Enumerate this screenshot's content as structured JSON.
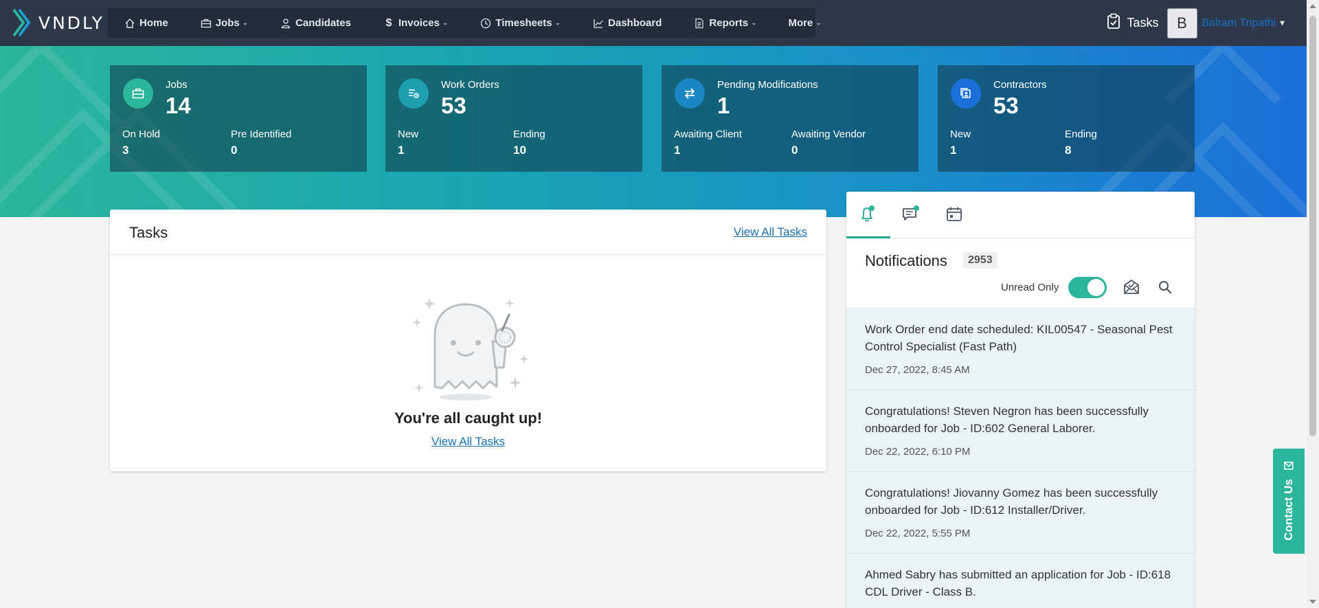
{
  "brand": {
    "name": "VNDLY"
  },
  "nav": {
    "items": [
      {
        "label": "Home",
        "icon": "home-icon",
        "dropdown": false
      },
      {
        "label": "Jobs",
        "icon": "briefcase-icon",
        "dropdown": true
      },
      {
        "label": "Candidates",
        "icon": "person-icon",
        "dropdown": false
      },
      {
        "label": "Invoices",
        "icon": "dollar-icon",
        "dropdown": true
      },
      {
        "label": "Timesheets",
        "icon": "clock-icon",
        "dropdown": true
      },
      {
        "label": "Dashboard",
        "icon": "chart-icon",
        "dropdown": false
      },
      {
        "label": "Reports",
        "icon": "document-icon",
        "dropdown": true
      },
      {
        "label": "More",
        "icon": "",
        "dropdown": true
      }
    ],
    "tasks_label": "Tasks",
    "avatar_initial": "B",
    "user_name": "Balram Tripathi"
  },
  "stats": [
    {
      "title": "Jobs",
      "value": "14",
      "icon": "briefcase-icon",
      "icon_color": "#2bb59b",
      "sub": [
        {
          "label": "On Hold",
          "value": "3"
        },
        {
          "label": "Pre Identified",
          "value": "0"
        }
      ]
    },
    {
      "title": "Work Orders",
      "value": "53",
      "icon": "work-order-icon",
      "icon_color": "#1d9fb0",
      "sub": [
        {
          "label": "New",
          "value": "1"
        },
        {
          "label": "Ending",
          "value": "10"
        }
      ]
    },
    {
      "title": "Pending Modifications",
      "value": "1",
      "icon": "swap-arrows-icon",
      "icon_color": "#1b86c4",
      "sub": [
        {
          "label": "Awaiting Client",
          "value": "1"
        },
        {
          "label": "Awaiting Vendor",
          "value": "0"
        }
      ]
    },
    {
      "title": "Contractors",
      "value": "53",
      "icon": "contractor-badge-icon",
      "icon_color": "#1b6fd8",
      "sub": [
        {
          "label": "New",
          "value": "1"
        },
        {
          "label": "Ending",
          "value": "8"
        }
      ]
    }
  ],
  "tasks_panel": {
    "title": "Tasks",
    "view_all": "View All Tasks",
    "empty_message": "You're all caught up!",
    "empty_link": "View All Tasks"
  },
  "notifications": {
    "title": "Notifications",
    "count": "2953",
    "unread_only_label": "Unread Only",
    "unread_only": true,
    "items": [
      {
        "message": "Work Order end date scheduled: KIL00547 - Seasonal Pest Control Specialist (Fast Path)",
        "time": "Dec 27, 2022, 8:45 AM"
      },
      {
        "message": "Congratulations! Steven Negron has been successfully onboarded for Job - ID:602 General Laborer.",
        "time": "Dec 22, 2022, 6:10 PM"
      },
      {
        "message": "Congratulations! Jiovanny Gomez has been successfully onboarded for Job - ID:612 Installer/Driver.",
        "time": "Dec 22, 2022, 5:55 PM"
      },
      {
        "message": "Ahmed Sabry has submitted an application for Job - ID:618 CDL Driver - Class B.",
        "time": ""
      }
    ]
  },
  "contact_us": {
    "label": "Contact Us"
  },
  "colors": {
    "accent": "#2bb59b",
    "nav_bg": "#2d3849",
    "link": "#1a6fb0"
  }
}
